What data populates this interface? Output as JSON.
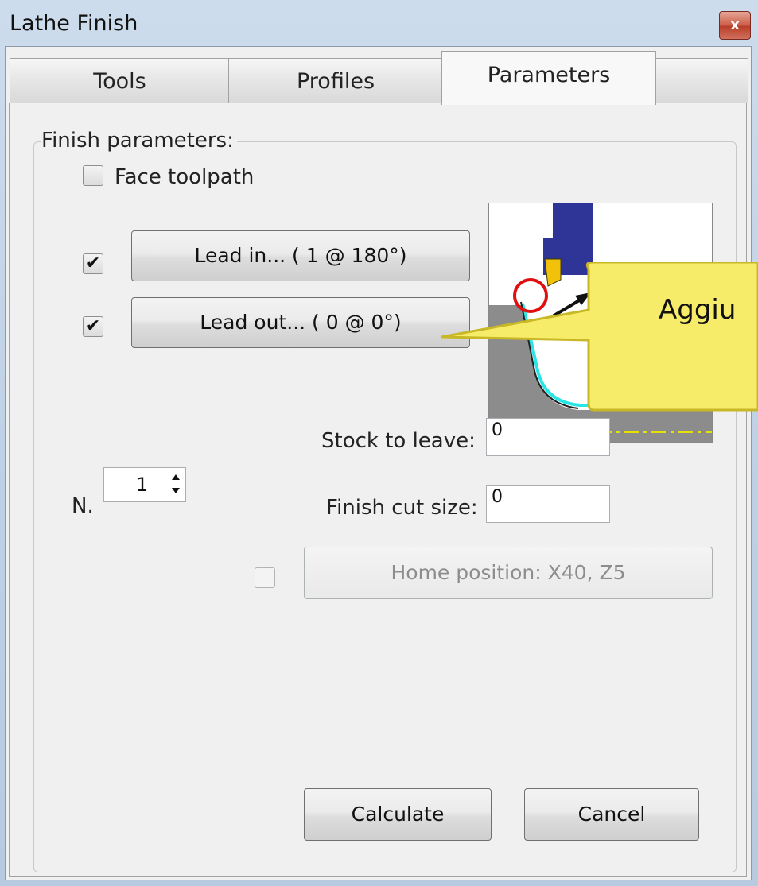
{
  "window": {
    "title": "Lathe Finish",
    "close_glyph": "x"
  },
  "tabs": [
    {
      "label": "Tools",
      "active": false
    },
    {
      "label": "Profiles",
      "active": false
    },
    {
      "label": "Parameters",
      "active": true
    }
  ],
  "finish_group": {
    "label": "Finish parameters:",
    "face_toolpath": {
      "label": "Face toolpath",
      "checked": false
    },
    "lead_in": {
      "checked": true,
      "button_label": "Lead in... ( 1 @ 180°)"
    },
    "lead_out": {
      "checked": true,
      "button_label": "Lead out... ( 0 @ 0°)"
    },
    "stock_to_leave": {
      "label": "Stock to leave:",
      "value": "0"
    },
    "finish_cut_size": {
      "label": "Finish cut size:",
      "value": "0"
    },
    "passes": {
      "label": "N.",
      "value": "1"
    },
    "home_position": {
      "checked": false,
      "enabled": false,
      "button_label": "Home position: X40, Z5"
    }
  },
  "buttons": {
    "calculate": "Calculate",
    "cancel": "Cancel"
  },
  "tooltip": {
    "text": "Aggiu"
  },
  "colors": {
    "tool_holder": "#2f3596",
    "insert": "#f2c20a",
    "stock": "#8c8c8c",
    "toolpath": "#29e6e6",
    "highlight_circle": "#e01010",
    "tooltip_fill": "#f7ec6a",
    "tooltip_border": "#c9b826"
  }
}
